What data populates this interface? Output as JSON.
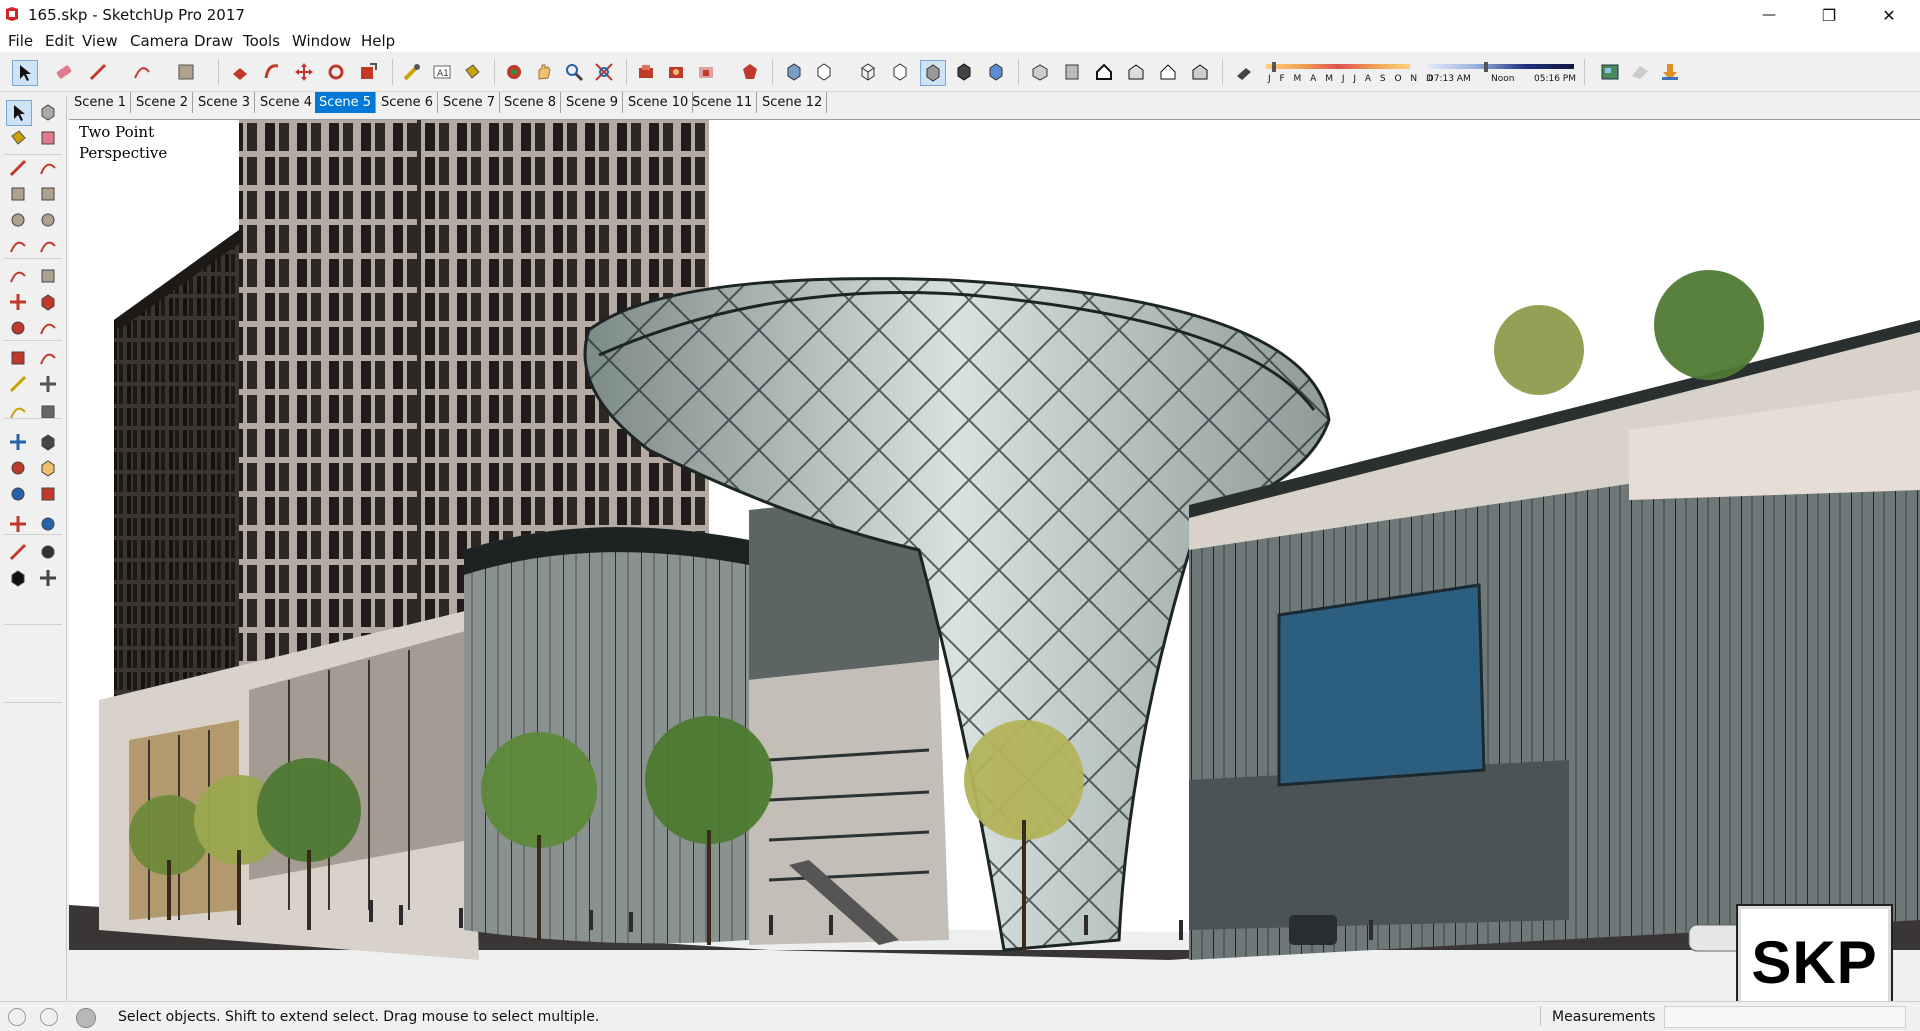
{
  "window": {
    "title": "165.skp - SketchUp Pro 2017",
    "minimize_glyph": "—",
    "restore_glyph": "❐",
    "close_glyph": "✕"
  },
  "menu": [
    "File",
    "Edit",
    "View",
    "Camera",
    "Draw",
    "Tools",
    "Window",
    "Help"
  ],
  "shadow_bar": {
    "months": "J F M A M J J A S O N D",
    "time_start": "07:13 AM",
    "time_mid": "Noon",
    "time_end": "05:16 PM"
  },
  "scenes": {
    "tabs": [
      "Scene 1",
      "Scene 2",
      "Scene 3",
      "Scene 4",
      "Scene 5",
      "Scene 6",
      "Scene 7",
      "Scene 8",
      "Scene 9",
      "Scene 10",
      "Scene 11",
      "Scene 12"
    ],
    "active": "Scene 5"
  },
  "viewport": {
    "label_line1": "Two Point",
    "label_line2": "Perspective"
  },
  "watermark": "SKP",
  "status": {
    "hint": "Select objects. Shift to extend select. Drag mouse to select multiple.",
    "measurements_label": "Measurements",
    "measurements_value": ""
  },
  "colors": {
    "accent": "#0078d7",
    "sky": "#ffffff",
    "tower": "#2e2a28",
    "glass": "#b9c6c4",
    "billboard": "#2c5f7f"
  }
}
